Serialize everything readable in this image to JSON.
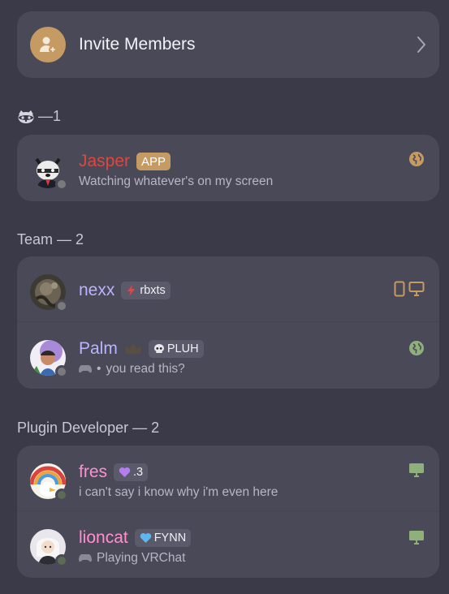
{
  "invite": {
    "label": "Invite Members"
  },
  "sections": {
    "raccoon": {
      "title": "—1"
    },
    "team": {
      "title": "Team — 2"
    },
    "plugin": {
      "title": "Plugin Developer — 2"
    }
  },
  "members": {
    "jasper": {
      "name": "Jasper",
      "name_color": "#e0463f",
      "badge": "APP",
      "status": "Watching whatever's on my screen"
    },
    "nexx": {
      "name": "nexx",
      "name_color": "#b9b4ff",
      "tag": "rbxts"
    },
    "palm": {
      "name": "Palm",
      "name_color": "#b9b4ff",
      "tag": "PLUH",
      "status": "you read this?",
      "separator": "•"
    },
    "fres": {
      "name": "fres",
      "name_color": "#ff8fd0",
      "tag": ".3",
      "status": "i can't say i know why i'm even here"
    },
    "lioncat": {
      "name": "lioncat",
      "name_color": "#ff8fd0",
      "tag": "FYNN",
      "status": "Playing VRChat"
    }
  },
  "colors": {
    "background": "#3b3a48",
    "card": "#4a4958",
    "accent_gold": "#c69a63",
    "online_green": "#8fb07b"
  },
  "icons": {
    "invite": "add-user-icon",
    "chevron": "chevron-right-icon",
    "web": "globe-icon",
    "mobile": "mobile-icon",
    "desktop": "desktop-icon"
  }
}
